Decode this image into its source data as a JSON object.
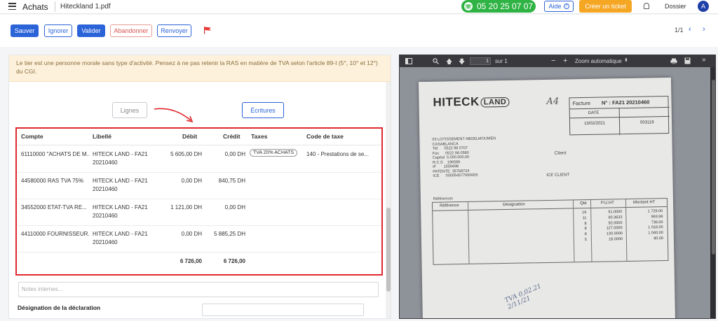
{
  "header": {
    "app_title": "Achats",
    "file_name": "Hiteckland 1.pdf",
    "phone": "05 20 25 07 07",
    "help_label": "Aide",
    "ticket_label": "Créer un ticket",
    "dossier_label": "Dossier",
    "avatar_initial": "A"
  },
  "toolbar": {
    "save": "Sauver",
    "ignore": "Ignorer",
    "validate": "Valider",
    "abandon": "Abandonner",
    "resend": "Renvoyer",
    "pager": "1/1",
    "prev": "‹",
    "next": "›"
  },
  "alert": {
    "text": "Le tier est une personne morale sans type d'activité. Pensez à ne pas retenir la RAS en matière de TVA selon l'article 89-I (5°, 10° et 12°) du CGI."
  },
  "tabs": {
    "lignes": "Lignes",
    "ecritures": "Écritures"
  },
  "table": {
    "headers": {
      "compte": "Compte",
      "libelle": "Libellé",
      "debit": "Débit",
      "credit": "Crédit",
      "taxes": "Taxes",
      "code_taxe": "Code de taxe"
    },
    "rows": [
      {
        "compte": "61110000 \"ACHATS DE M...",
        "libelle_1": "HITECK LAND - FA21",
        "libelle_2": "20210460",
        "debit": "5 605,00 DH",
        "credit": "0,00 DH",
        "taxe": "TVA 20% ACHATS",
        "code_taxe": "140 - Prestations de se..."
      },
      {
        "compte": "44580000 RAS TVA 75%",
        "libelle_1": "HITECK LAND - FA21",
        "libelle_2": "20210460",
        "debit": "0,00 DH",
        "credit": "840,75 DH",
        "taxe": "",
        "code_taxe": ""
      },
      {
        "compte": "34552000 ETAT-TVA RE...",
        "libelle_1": "HITECK LAND - FA21",
        "libelle_2": "20210460",
        "debit": "1 121,00 DH",
        "credit": "0,00 DH",
        "taxe": "",
        "code_taxe": ""
      },
      {
        "compte": "44110000 FOURNISSEUR...",
        "libelle_1": "HITECK LAND - FA21",
        "libelle_2": "20210460",
        "debit": "0,00 DH",
        "credit": "5 885,25 DH",
        "taxe": "",
        "code_taxe": ""
      }
    ],
    "total_debit": "6 726,00",
    "total_credit": "6 726,00"
  },
  "notes": {
    "placeholder": "Notes internes..."
  },
  "declaration": {
    "label": "Désignation de la déclaration"
  },
  "viewer": {
    "page_number": "1",
    "page_total": "sur 1",
    "zoom_label": "Zoom automatique",
    "zoom_out": "−",
    "zoom_in": "+"
  },
  "invoice": {
    "brand": "HITECK",
    "brand_land": "LAND",
    "handwritten_a4": "A4",
    "facture_label": "Facture",
    "facture_number": "N° : FA21 20210460",
    "date_label": "DATE",
    "date_value": "13/02/2021",
    "ref_value": "003119",
    "address": "03 LOTISSEMENT ABDELMOUMEN\nCASABLANCA\nTél      0522 98 0707\nFax      0522 98 0580\nCapital  5.000.000,00\nR.C.S    196589\nIF       1559498\nPATENTE  35768724\nICE      000054577000005",
    "client_label": "Client",
    "ice_label": "ICE CLIENT",
    "references_label": "Références",
    "col_ref": "Référence",
    "col_designation": "Désignation",
    "col_qte": "Qté",
    "col_pu": "P.U.HT",
    "col_montant": "Montant HT",
    "qtes": "19\n11\n8\n8\n8\n5",
    "pus": "91.0000\n90.3633\n92.0000\n127.0000\n130.0000\n18.0000",
    "montants": "1 729.00\n993.99\n736.00\n1 016.00\n1 040.00\n90.00",
    "handwriting": "TVA 0,02.21\n2/11/21"
  }
}
